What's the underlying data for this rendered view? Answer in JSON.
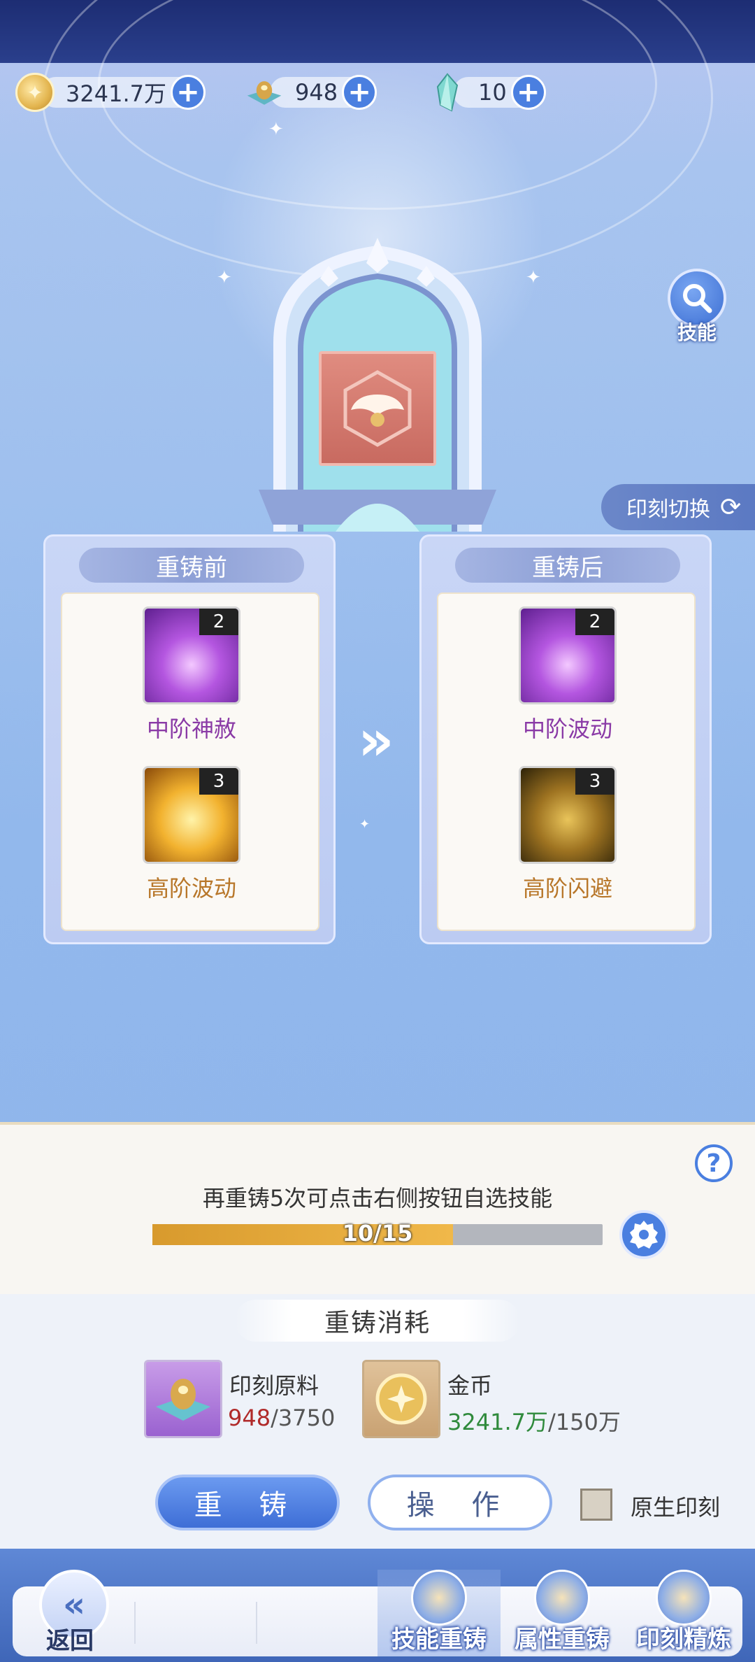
{
  "currencies": [
    {
      "name": "gold-coin",
      "value": "3241.7万"
    },
    {
      "name": "imprint-ore",
      "value": "948"
    },
    {
      "name": "crystal",
      "value": "10"
    }
  ],
  "skill_button": {
    "label": "技能"
  },
  "imprint_switch": {
    "label": "印刻切换"
  },
  "before": {
    "title": "重铸前",
    "skills": [
      {
        "name": "中阶神赦",
        "level": "2",
        "icon": "purple-wings-icon"
      },
      {
        "name": "高阶波动",
        "level": "3",
        "icon": "golden-wave-icon"
      }
    ]
  },
  "after": {
    "title": "重铸后",
    "skills": [
      {
        "name": "中阶波动",
        "level": "2",
        "icon": "purple-wave-icon"
      },
      {
        "name": "高阶闪避",
        "level": "3",
        "icon": "golden-ghost-icon"
      }
    ]
  },
  "reforge": {
    "hint": "再重铸5次可点击右侧按钮自选技能",
    "progress_text": "10/15",
    "progress_value": 0.667,
    "cost_title": "重铸消耗",
    "materials": [
      {
        "name": "印刻原料",
        "have": "948",
        "need": "/3750"
      },
      {
        "name": "金币",
        "have": "3241.7万",
        "need": "/150万"
      }
    ],
    "primary_button": "重 铸",
    "secondary_button": "操 作",
    "checkbox_label": "原生印刻"
  },
  "nav": {
    "back": "返回",
    "tabs": [
      "技能重铸",
      "属性重铸",
      "印刻精炼"
    ]
  },
  "colors": {
    "accent": "#4a7fe0",
    "progress": "#f0b84a",
    "red_text": "#b02a2a",
    "green_text": "#2f8a3c"
  }
}
